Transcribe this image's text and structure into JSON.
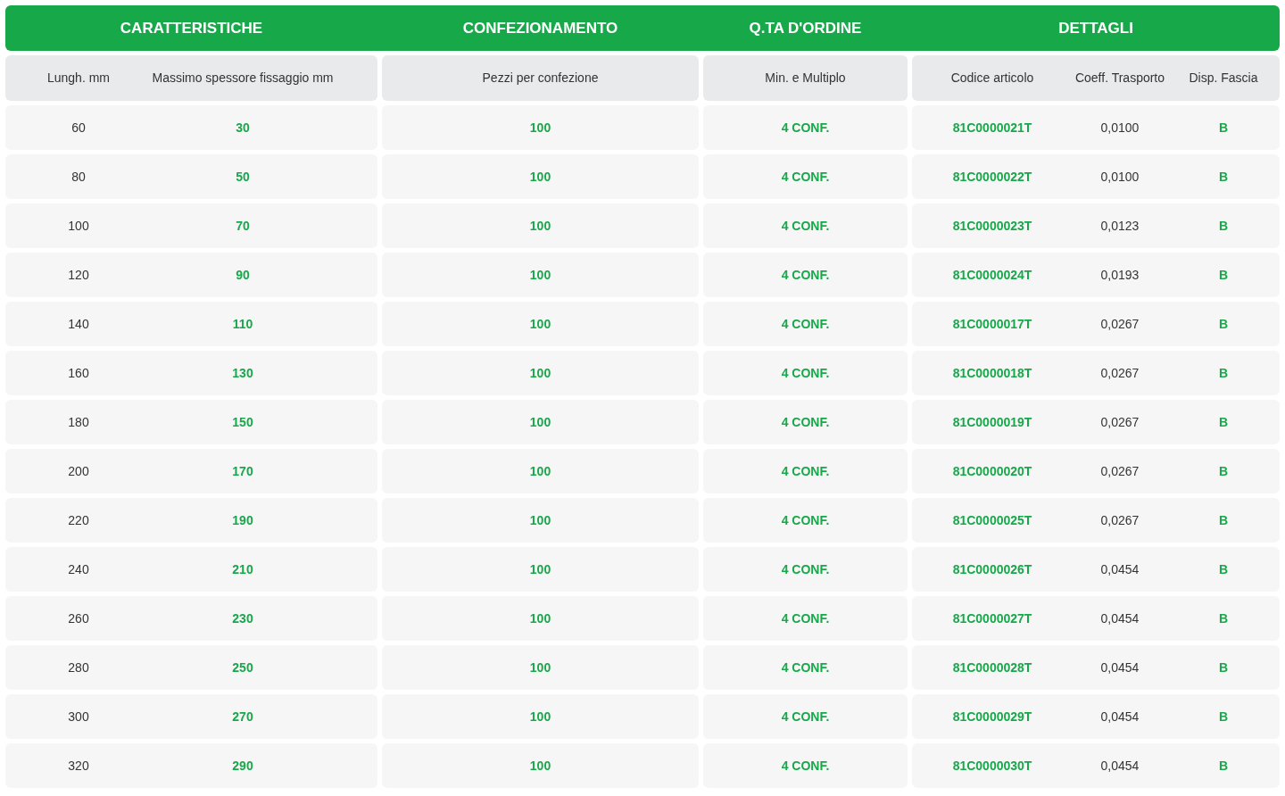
{
  "table": {
    "groups": [
      "CARATTERISTICHE",
      "CONFEZIONAMENTO",
      "Q.TA D'ORDINE",
      "DETTAGLI"
    ],
    "columns": [
      "Lungh. mm",
      "Massimo spessore fissaggio mm",
      "Pezzi per confezione",
      "Min. e Multiplo",
      "Codice articolo",
      "Coeff. Trasporto",
      "Disp. Fascia"
    ],
    "rows": [
      [
        "60",
        "30",
        "100",
        "4 CONF.",
        "81C0000021T",
        "0,0100",
        "B"
      ],
      [
        "80",
        "50",
        "100",
        "4 CONF.",
        "81C0000022T",
        "0,0100",
        "B"
      ],
      [
        "100",
        "70",
        "100",
        "4 CONF.",
        "81C0000023T",
        "0,0123",
        "B"
      ],
      [
        "120",
        "90",
        "100",
        "4 CONF.",
        "81C0000024T",
        "0,0193",
        "B"
      ],
      [
        "140",
        "110",
        "100",
        "4 CONF.",
        "81C0000017T",
        "0,0267",
        "B"
      ],
      [
        "160",
        "130",
        "100",
        "4 CONF.",
        "81C0000018T",
        "0,0267",
        "B"
      ],
      [
        "180",
        "150",
        "100",
        "4 CONF.",
        "81C0000019T",
        "0,0267",
        "B"
      ],
      [
        "200",
        "170",
        "100",
        "4 CONF.",
        "81C0000020T",
        "0,0267",
        "B"
      ],
      [
        "220",
        "190",
        "100",
        "4 CONF.",
        "81C0000025T",
        "0,0267",
        "B"
      ],
      [
        "240",
        "210",
        "100",
        "4 CONF.",
        "81C0000026T",
        "0,0454",
        "B"
      ],
      [
        "260",
        "230",
        "100",
        "4 CONF.",
        "81C0000027T",
        "0,0454",
        "B"
      ],
      [
        "280",
        "250",
        "100",
        "4 CONF.",
        "81C0000028T",
        "0,0454",
        "B"
      ],
      [
        "300",
        "270",
        "100",
        "4 CONF.",
        "81C0000029T",
        "0,0454",
        "B"
      ],
      [
        "320",
        "290",
        "100",
        "4 CONF.",
        "81C0000030T",
        "0,0454",
        "B"
      ]
    ]
  }
}
